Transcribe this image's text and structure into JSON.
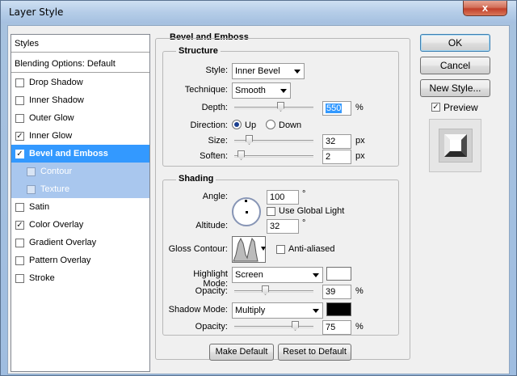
{
  "window": {
    "title": "Layer Style",
    "close_glyph": "x"
  },
  "style_list": {
    "header": "Styles",
    "blending": "Blending Options: Default",
    "items": [
      {
        "label": "Drop Shadow",
        "checked": false
      },
      {
        "label": "Inner Shadow",
        "checked": false
      },
      {
        "label": "Outer Glow",
        "checked": false
      },
      {
        "label": "Inner Glow",
        "checked": true
      },
      {
        "label": "Bevel and Emboss",
        "checked": true,
        "active": true
      },
      {
        "label": "Contour",
        "checked": false,
        "sub": true
      },
      {
        "label": "Texture",
        "checked": false,
        "sub": true
      },
      {
        "label": "Satin",
        "checked": false
      },
      {
        "label": "Color Overlay",
        "checked": true
      },
      {
        "label": "Gradient Overlay",
        "checked": false
      },
      {
        "label": "Pattern Overlay",
        "checked": false
      },
      {
        "label": "Stroke",
        "checked": false
      }
    ]
  },
  "bevel": {
    "title": "Bevel and Emboss",
    "structure": {
      "title": "Structure",
      "style_label": "Style:",
      "style_value": "Inner Bevel",
      "technique_label": "Technique:",
      "technique_value": "Smooth",
      "depth_label": "Depth:",
      "depth_value": "550",
      "depth_unit": "%",
      "direction_label": "Direction:",
      "dir_up": "Up",
      "dir_down": "Down",
      "size_label": "Size:",
      "size_value": "32",
      "size_unit": "px",
      "soften_label": "Soften:",
      "soften_value": "2",
      "soften_unit": "px"
    },
    "shading": {
      "title": "Shading",
      "angle_label": "Angle:",
      "angle_value": "100",
      "angle_unit": "°",
      "global_light": "Use Global Light",
      "altitude_label": "Altitude:",
      "altitude_value": "32",
      "altitude_unit": "°",
      "gloss_label": "Gloss Contour:",
      "anti_aliased": "Anti-aliased",
      "highlight_label": "Highlight Mode:",
      "highlight_value": "Screen",
      "highlight_color": "#ffffff",
      "hl_opacity_label": "Opacity:",
      "hl_opacity_value": "39",
      "hl_opacity_unit": "%",
      "shadow_label": "Shadow Mode:",
      "shadow_value": "Multiply",
      "shadow_color": "#000000",
      "sh_opacity_label": "Opacity:",
      "sh_opacity_value": "75",
      "sh_opacity_unit": "%"
    },
    "make_default": "Make Default",
    "reset_default": "Reset to Default"
  },
  "actions": {
    "ok": "OK",
    "cancel": "Cancel",
    "new_style": "New Style...",
    "preview": "Preview",
    "preview_checked": true
  }
}
